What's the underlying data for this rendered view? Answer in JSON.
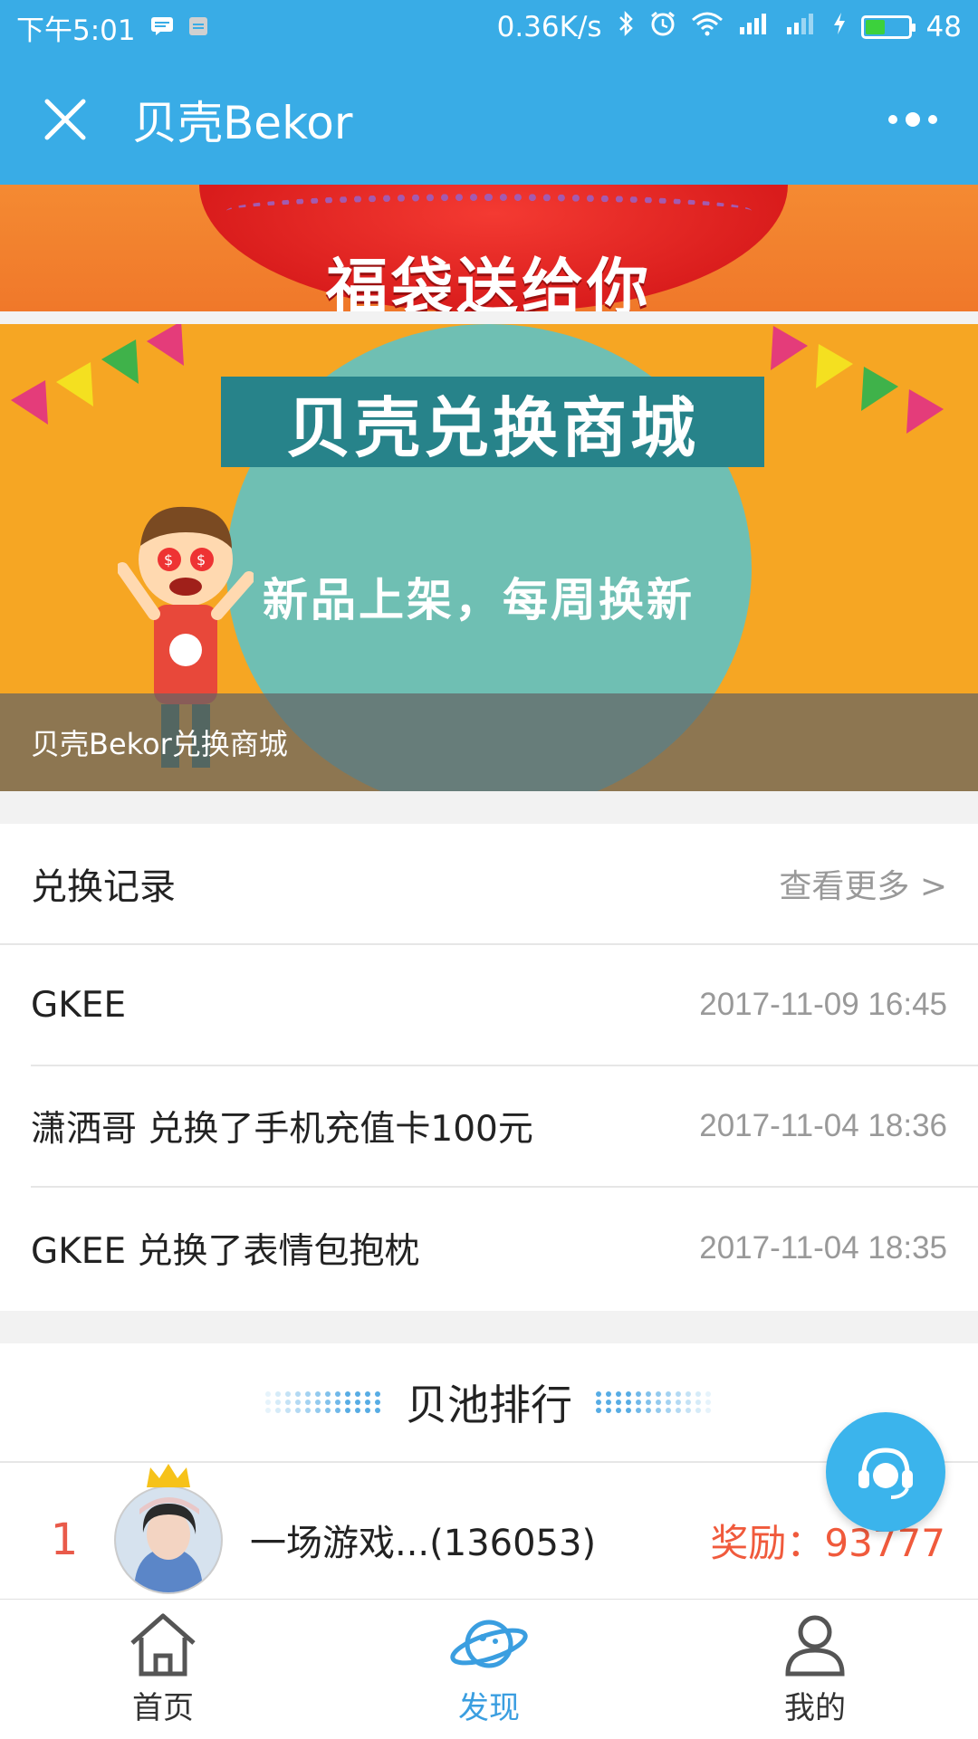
{
  "status_bar": {
    "time": "下午5:01",
    "network_speed": "0.36K/s",
    "battery": "48",
    "battery_level": 0.48
  },
  "header": {
    "title": "贝壳Bekor",
    "close_icon": "close-icon",
    "more_icon": "more-dots-icon"
  },
  "banners": {
    "top_banner_text": "福袋送给你",
    "main_banner": {
      "title": "贝壳兑换商城",
      "subtitle": "新品上架，每周换新",
      "caption": "贝壳Bekor兑换商城"
    }
  },
  "records": {
    "heading": "兑换记录",
    "more_label": "查看更多 >",
    "items": [
      {
        "text": "GKEE",
        "time": "2017-11-09 16:45"
      },
      {
        "text": "潇洒哥 兑换了手机充值卡100元",
        "time": "2017-11-04 18:36"
      },
      {
        "text": "GKEE 兑换了表情包抱枕",
        "time": "2017-11-04 18:35"
      }
    ]
  },
  "ranking": {
    "heading": "贝池排行",
    "entries": [
      {
        "rank": "1",
        "name": "一场游戏...(136053)",
        "reward": "奖励：93777"
      }
    ]
  },
  "tabs": [
    {
      "label": "首页",
      "icon": "home-icon"
    },
    {
      "label": "发现",
      "icon": "planet-icon",
      "active": true
    },
    {
      "label": "我的",
      "icon": "user-icon"
    }
  ],
  "colors": {
    "brand_blue": "#39ace6",
    "accent_red": "#f05a3c",
    "active_tab": "#3a9ee0"
  }
}
